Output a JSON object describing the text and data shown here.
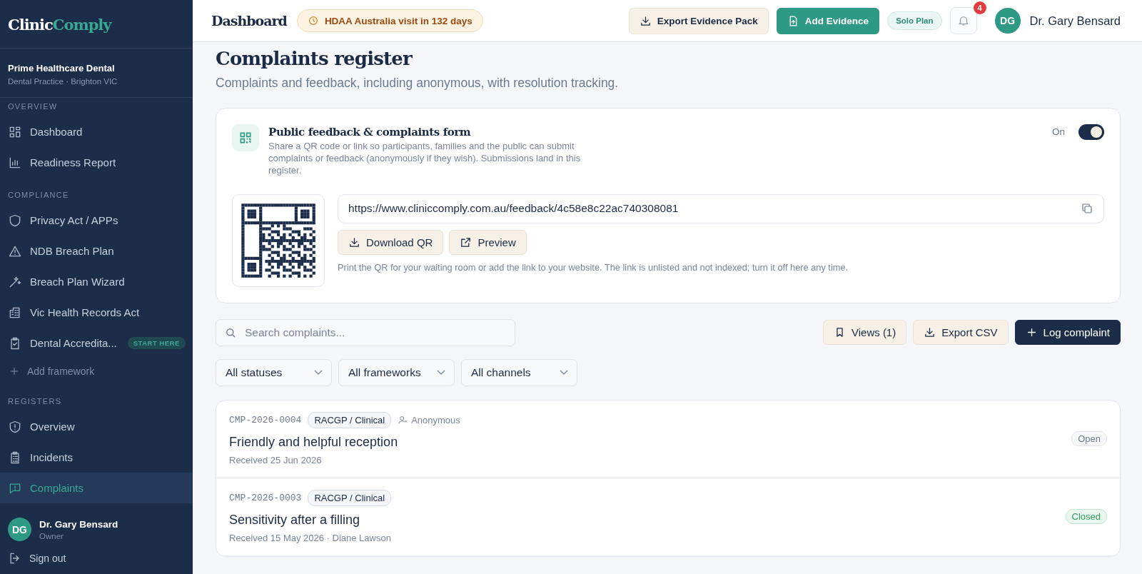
{
  "sidebar": {
    "logo": {
      "part1": "Clinic",
      "part2": "Comply"
    },
    "org": {
      "name": "Prime Healthcare Dental",
      "subtitle": "Dental Practice · Brighton VIC"
    },
    "sections": [
      {
        "label": "OVERVIEW",
        "items": [
          {
            "label": "Dashboard",
            "selected": false
          },
          {
            "label": "Readiness Report",
            "selected": false
          }
        ]
      },
      {
        "label": "COMPLIANCE",
        "items": [
          {
            "label": "Privacy Act / APPs",
            "selected": false
          },
          {
            "label": "NDB Breach Plan",
            "selected": false
          },
          {
            "label": "Breach Plan Wizard",
            "selected": false
          },
          {
            "label": "Vic Health Records Act",
            "selected": false
          },
          {
            "label": "Dental Accredita...",
            "selected": false,
            "badge": "START HERE"
          }
        ],
        "add": "Add framework"
      },
      {
        "label": "REGISTERS",
        "items": [
          {
            "label": "Overview",
            "selected": false
          },
          {
            "label": "Incidents",
            "selected": false
          },
          {
            "label": "Complaints",
            "selected": true
          }
        ]
      }
    ],
    "user": {
      "initials": "DG",
      "name": "Dr. Gary Bensard",
      "role": "Owner"
    },
    "sign_out": "Sign out"
  },
  "topbar": {
    "title": "Dashboard",
    "visit_badge": "HDAA Australia visit in 132 days",
    "export_button": "Export Evidence Pack",
    "add_button": "Add Evidence",
    "plan": "Solo Plan",
    "notifications": "4",
    "user": {
      "initials": "DG",
      "name": "Dr. Gary Bensard"
    }
  },
  "page": {
    "title": "Complaints register",
    "subtitle": "Complaints and feedback, including anonymous, with resolution tracking."
  },
  "feedback_form": {
    "title": "Public feedback & complaints form",
    "description": "Share a QR code or link so participants, families and the public can submit complaints or feedback (anonymously if they wish). Submissions land in this register.",
    "toggle_label": "On",
    "on": true,
    "url": "https://www.cliniccomply.com.au/feedback/4c58e8c22ac740308081",
    "download_button": "Download QR",
    "preview_button": "Preview",
    "hint": "Print the QR for your waiting room or add the link to your website. The link is unlisted and not indexed; turn it off here any time."
  },
  "toolbar": {
    "search": {
      "placeholder": "Search complaints..."
    },
    "views_button": "Views (1)",
    "export_button": "Export CSV",
    "log_button": "Log complaint"
  },
  "filters": [
    "All statuses",
    "All frameworks",
    "All channels"
  ],
  "complaints": [
    {
      "id": "CMP-2026-0004",
      "tag": "RACGP / Clinical",
      "anonymous": "Anonymous",
      "title": "Friendly and helpful reception",
      "meta": "Received 25 Jun 2026",
      "status": "Open",
      "kind": "open"
    },
    {
      "id": "CMP-2026-0003",
      "tag": "RACGP / Clinical",
      "title": "Sensitivity after a filling",
      "meta": "Received 15 May 2026 · Diane Lawson",
      "status": "Closed",
      "kind": "closed"
    }
  ]
}
